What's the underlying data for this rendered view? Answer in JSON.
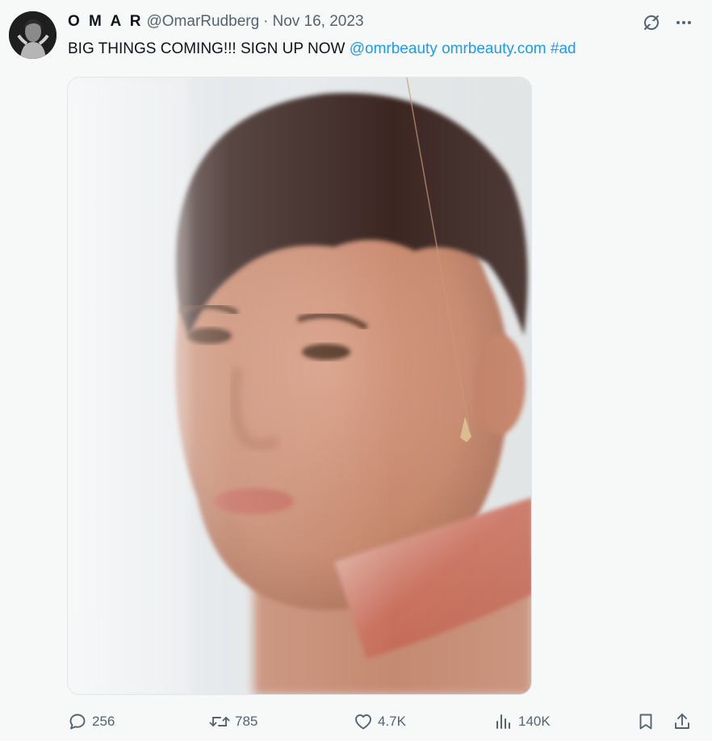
{
  "author": {
    "display_name": "O M A R",
    "handle": "@OmarRudberg",
    "separator": "·",
    "date": "Nov 16, 2023"
  },
  "tweet": {
    "text": "BIG THINGS COMING!!! SIGN UP NOW",
    "mention": "@omrbeauty",
    "url": "omrbeauty.com",
    "hashtag": "#ad"
  },
  "stats": {
    "replies": "256",
    "retweets": "785",
    "likes": "4.7K",
    "views": "140K"
  },
  "icons": {
    "grok": "grok-icon",
    "more": "more-horizontal-icon",
    "reply": "reply-icon",
    "retweet": "retweet-icon",
    "like": "heart-icon",
    "views": "views-icon",
    "bookmark": "bookmark-icon",
    "share": "share-icon"
  },
  "colors": {
    "link": "#1d9bf0",
    "secondary_text": "#536471",
    "primary_text": "#0f1419",
    "background": "#f7f9f9"
  }
}
